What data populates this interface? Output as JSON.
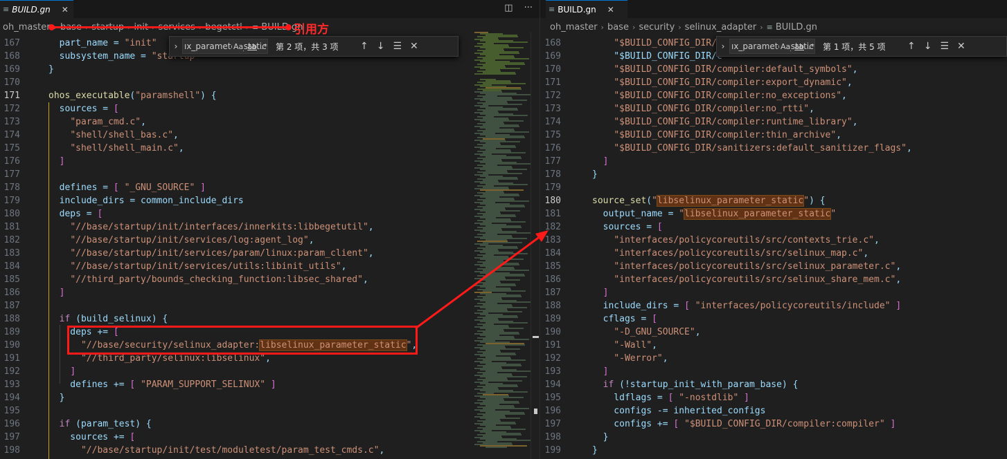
{
  "annotation": {
    "label": "引用方"
  },
  "left": {
    "tab": {
      "title": "BUILD.gn",
      "close": "✕"
    },
    "actions": {
      "split": "◫",
      "more": "···"
    },
    "breadcrumb": [
      "oh_master",
      "base",
      "startup",
      "init",
      "services",
      "begetctl",
      "BUILD.gn"
    ],
    "find": {
      "query": "ıx_parameter_static",
      "case": "Aa",
      "word": "ab",
      "regex": ".*",
      "count": "第 2 项，共 3 项"
    },
    "lines": [
      {
        "n": "167",
        "t": "  part_name = \"init\""
      },
      {
        "n": "168",
        "t": "  subsystem_name = \"startup\""
      },
      {
        "n": "169",
        "t": "}"
      },
      {
        "n": "170",
        "t": ""
      },
      {
        "n": "171",
        "t": "ohos_executable(\"paramshell\") {"
      },
      {
        "n": "172",
        "t": "  sources = ["
      },
      {
        "n": "173",
        "t": "    \"param_cmd.c\","
      },
      {
        "n": "174",
        "t": "    \"shell/shell_bas.c\","
      },
      {
        "n": "175",
        "t": "    \"shell/shell_main.c\","
      },
      {
        "n": "176",
        "t": "  ]"
      },
      {
        "n": "177",
        "t": ""
      },
      {
        "n": "178",
        "t": "  defines = [ \"_GNU_SOURCE\" ]"
      },
      {
        "n": "179",
        "t": "  include_dirs = common_include_dirs"
      },
      {
        "n": "180",
        "t": "  deps = ["
      },
      {
        "n": "181",
        "t": "    \"//base/startup/init/interfaces/innerkits:libbegetutil\","
      },
      {
        "n": "182",
        "t": "    \"//base/startup/init/services/log:agent_log\","
      },
      {
        "n": "183",
        "t": "    \"//base/startup/init/services/param/linux:param_client\","
      },
      {
        "n": "184",
        "t": "    \"//base/startup/init/services/utils:libinit_utils\","
      },
      {
        "n": "185",
        "t": "    \"//third_party/bounds_checking_function:libsec_shared\","
      },
      {
        "n": "186",
        "t": "  ]"
      },
      {
        "n": "187",
        "t": ""
      },
      {
        "n": "188",
        "t": "  if (build_selinux) {"
      },
      {
        "n": "189",
        "t": "    deps += ["
      },
      {
        "n": "190",
        "t": "      \"//base/security/selinux_adapter:libselinux_parameter_static\","
      },
      {
        "n": "191",
        "t": "      \"//third_party/selinux:libselinux\","
      },
      {
        "n": "192",
        "t": "    ]"
      },
      {
        "n": "193",
        "t": "    defines += [ \"PARAM_SUPPORT_SELINUX\" ]"
      },
      {
        "n": "194",
        "t": "  }"
      },
      {
        "n": "195",
        "t": ""
      },
      {
        "n": "196",
        "t": "  if (param_test) {"
      },
      {
        "n": "197",
        "t": "    sources += ["
      },
      {
        "n": "198",
        "t": "      \"//base/startup/init/test/moduletest/param_test_cmds.c\","
      }
    ]
  },
  "right": {
    "tab": {
      "title": "BUILD.gn",
      "close": "✕"
    },
    "breadcrumb": [
      "oh_master",
      "base",
      "security",
      "selinux_adapter",
      "BUILD.gn"
    ],
    "find": {
      "query": "ıx_parameter_static",
      "case": "Aa",
      "word": "ab",
      "regex": ".*",
      "count": "第 1 项，共 5 项"
    },
    "lines": [
      {
        "n": "168",
        "t": "    \"$BUILD_CONFIG_DIR/compiler:...\","
      },
      {
        "n": "169",
        "t": "    \"$BUILD_CONFIG_DIR/c"
      },
      {
        "n": "170",
        "t": "    \"$BUILD_CONFIG_DIR/compiler:default_symbols\","
      },
      {
        "n": "171",
        "t": "    \"$BUILD_CONFIG_DIR/compiler:export_dynamic\","
      },
      {
        "n": "172",
        "t": "    \"$BUILD_CONFIG_DIR/compiler:no_exceptions\","
      },
      {
        "n": "173",
        "t": "    \"$BUILD_CONFIG_DIR/compiler:no_rtti\","
      },
      {
        "n": "174",
        "t": "    \"$BUILD_CONFIG_DIR/compiler:runtime_library\","
      },
      {
        "n": "175",
        "t": "    \"$BUILD_CONFIG_DIR/compiler:thin_archive\","
      },
      {
        "n": "176",
        "t": "    \"$BUILD_CONFIG_DIR/sanitizers:default_sanitizer_flags\","
      },
      {
        "n": "177",
        "t": "  ]"
      },
      {
        "n": "178",
        "t": "}"
      },
      {
        "n": "179",
        "t": ""
      },
      {
        "n": "180",
        "t": "source_set(\"libselinux_parameter_static\") {"
      },
      {
        "n": "181",
        "t": "  output_name = \"libselinux_parameter_static\""
      },
      {
        "n": "182",
        "t": "  sources = ["
      },
      {
        "n": "183",
        "t": "    \"interfaces/policycoreutils/src/contexts_trie.c\","
      },
      {
        "n": "184",
        "t": "    \"interfaces/policycoreutils/src/selinux_map.c\","
      },
      {
        "n": "185",
        "t": "    \"interfaces/policycoreutils/src/selinux_parameter.c\","
      },
      {
        "n": "186",
        "t": "    \"interfaces/policycoreutils/src/selinux_share_mem.c\","
      },
      {
        "n": "187",
        "t": "  ]"
      },
      {
        "n": "188",
        "t": "  include_dirs = [ \"interfaces/policycoreutils/include\" ]"
      },
      {
        "n": "189",
        "t": "  cflags = ["
      },
      {
        "n": "190",
        "t": "    \"-D_GNU_SOURCE\","
      },
      {
        "n": "191",
        "t": "    \"-Wall\","
      },
      {
        "n": "192",
        "t": "    \"-Werror\","
      },
      {
        "n": "193",
        "t": "  ]"
      },
      {
        "n": "194",
        "t": "  if (!startup_init_with_param_base) {"
      },
      {
        "n": "195",
        "t": "    ldflags = [ \"-nostdlib\" ]"
      },
      {
        "n": "196",
        "t": "    configs -= inherited_configs"
      },
      {
        "n": "197",
        "t": "    configs += [ \"$BUILD_CONFIG_DIR/compiler:compiler\" ]"
      },
      {
        "n": "198",
        "t": "  }"
      },
      {
        "n": "199",
        "t": "}"
      },
      {
        "n": "200",
        "t": ""
      }
    ]
  },
  "colors": {
    "accent": "#0078d4",
    "annotation": "#ff1a1a",
    "match": "#613214"
  }
}
